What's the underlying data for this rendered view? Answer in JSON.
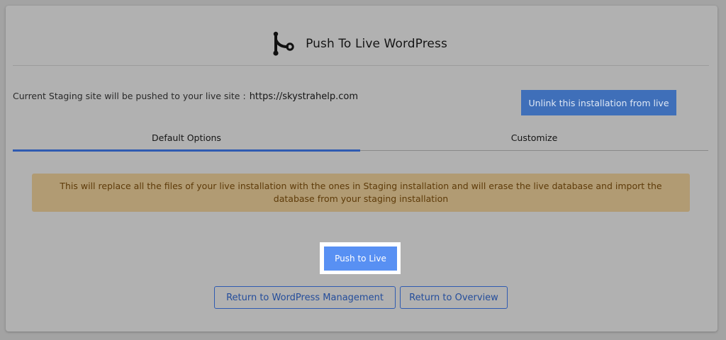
{
  "header": {
    "title": "Push To Live WordPress",
    "icon": "git-branch-icon"
  },
  "staging": {
    "label": "Current Staging site will be pushed to your live site :",
    "url": "https://skystrahelp.com"
  },
  "unlink_button": {
    "label": "Unlink this installation from live"
  },
  "tabs": [
    {
      "label": "Default Options",
      "active": true
    },
    {
      "label": "Customize",
      "active": false
    }
  ],
  "warning": {
    "text": "This will replace all the files of your live installation with the ones in Staging installation and will erase the live database and import the database from your staging installation"
  },
  "actions": {
    "push_label": "Push to Live",
    "return_wp_label": "Return to WordPress Management",
    "return_overview_label": "Return to Overview"
  },
  "colors": {
    "accent": "#3f6fb9",
    "push_button": "#5890f3",
    "warning_bg": "#b19b73",
    "warning_text": "#5e3b09"
  }
}
